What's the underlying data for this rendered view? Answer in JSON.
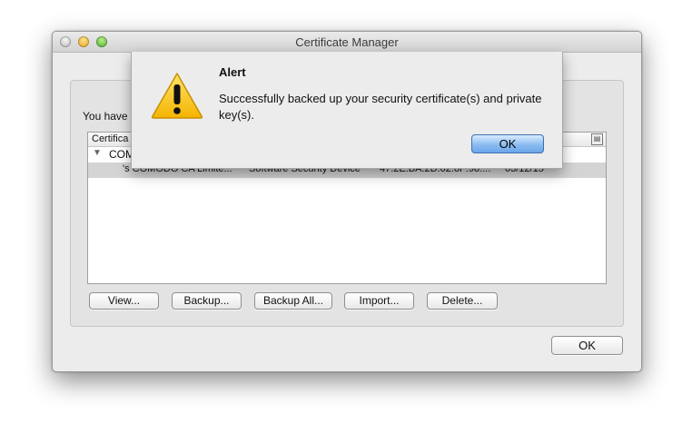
{
  "window": {
    "title": "Certificate Manager"
  },
  "main": {
    "intro_text": "You have",
    "table": {
      "header_col0": "Certifica",
      "group_label": "COM",
      "selected_row": {
        "name": "'s COMODO CA Limite...",
        "device": "Software Security Device",
        "serial": "47:2E:BA:2D:02:8F:98:...",
        "expires": "03/12/15"
      }
    },
    "buttons": {
      "view": "View...",
      "backup": "Backup...",
      "backup_all": "Backup All...",
      "import": "Import...",
      "delete": "Delete..."
    },
    "ok_label": "OK"
  },
  "alert": {
    "title": "Alert",
    "message": "Successfully backed up your security certificate(s) and private key(s).",
    "ok_label": "OK",
    "icon": "warning-icon"
  }
}
